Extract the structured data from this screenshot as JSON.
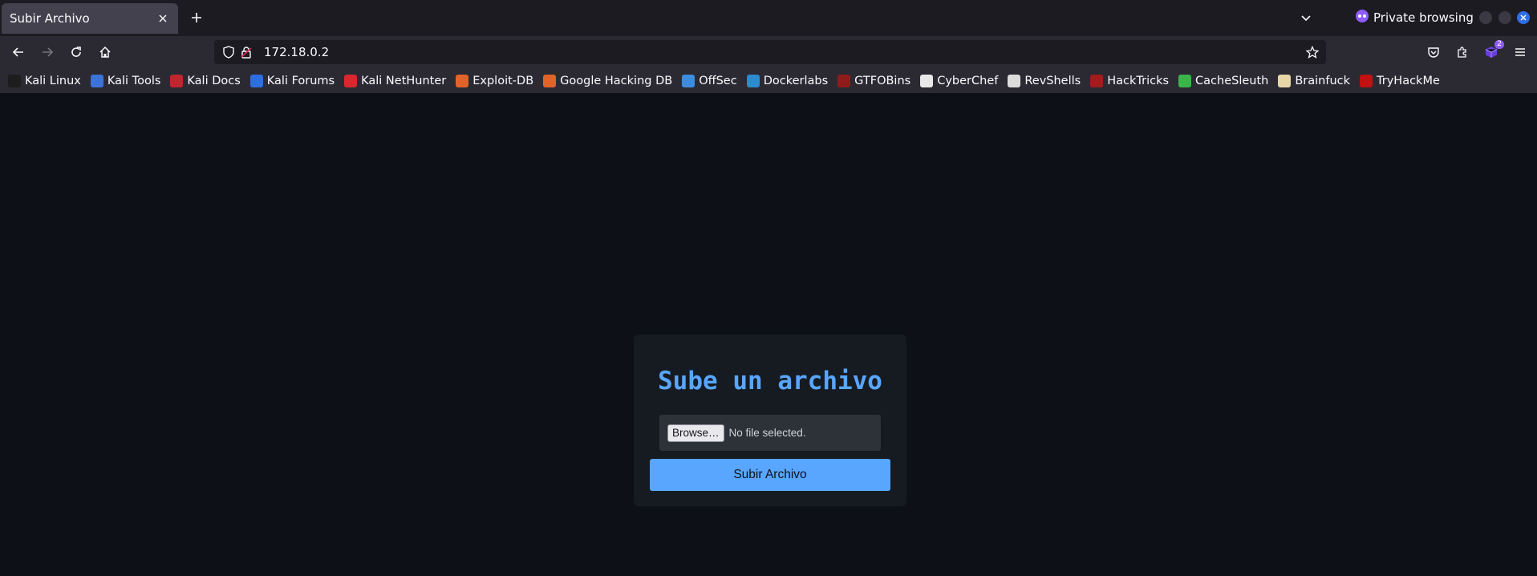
{
  "browser": {
    "tab_title": "Subir Archivo",
    "private_label": "Private browsing",
    "url": "172.18.0.2",
    "extension_badge": "2"
  },
  "bookmarks": [
    {
      "label": "Kali Linux",
      "icon": "kali-dragon-icon",
      "color": "#1d1d1d"
    },
    {
      "label": "Kali Tools",
      "icon": "kali-tools-icon",
      "color": "#3b73d9"
    },
    {
      "label": "Kali Docs",
      "icon": "kali-docs-icon",
      "color": "#c0262d"
    },
    {
      "label": "Kali Forums",
      "icon": "kali-forums-icon",
      "color": "#2d6fe0"
    },
    {
      "label": "Kali NetHunter",
      "icon": "nethunter-icon",
      "color": "#d9272e"
    },
    {
      "label": "Exploit-DB",
      "icon": "exploit-db-icon",
      "color": "#e0642a"
    },
    {
      "label": "Google Hacking DB",
      "icon": "ghdb-icon",
      "color": "#e0642a"
    },
    {
      "label": "OffSec",
      "icon": "offsec-icon",
      "color": "#3c8de0"
    },
    {
      "label": "Dockerlabs",
      "icon": "dockerlabs-icon",
      "color": "#2a8ccf"
    },
    {
      "label": "GTFOBins",
      "icon": "gtfobins-icon",
      "color": "#8f1b1b"
    },
    {
      "label": "CyberChef",
      "icon": "cyberchef-icon",
      "color": "#e8e8e8"
    },
    {
      "label": "RevShells",
      "icon": "skull-icon",
      "color": "#dcdcdc"
    },
    {
      "label": "HackTricks",
      "icon": "hacktricks-icon",
      "color": "#a31b1b"
    },
    {
      "label": "CacheSleuth",
      "icon": "cachesleuth-icon",
      "color": "#39b54a"
    },
    {
      "label": "Brainfuck",
      "icon": "brainfuck-icon",
      "color": "#e7d6a8"
    },
    {
      "label": "TryHackMe",
      "icon": "tryhackme-icon",
      "color": "#c11111"
    }
  ],
  "page": {
    "title": "Sube un archivo",
    "browse_label": "Browse…",
    "file_status": "No file selected.",
    "submit_label": "Subir Archivo"
  },
  "colors": {
    "page_bg": "#0d1117",
    "card_bg": "#161b22",
    "accent": "#58a6ff"
  }
}
